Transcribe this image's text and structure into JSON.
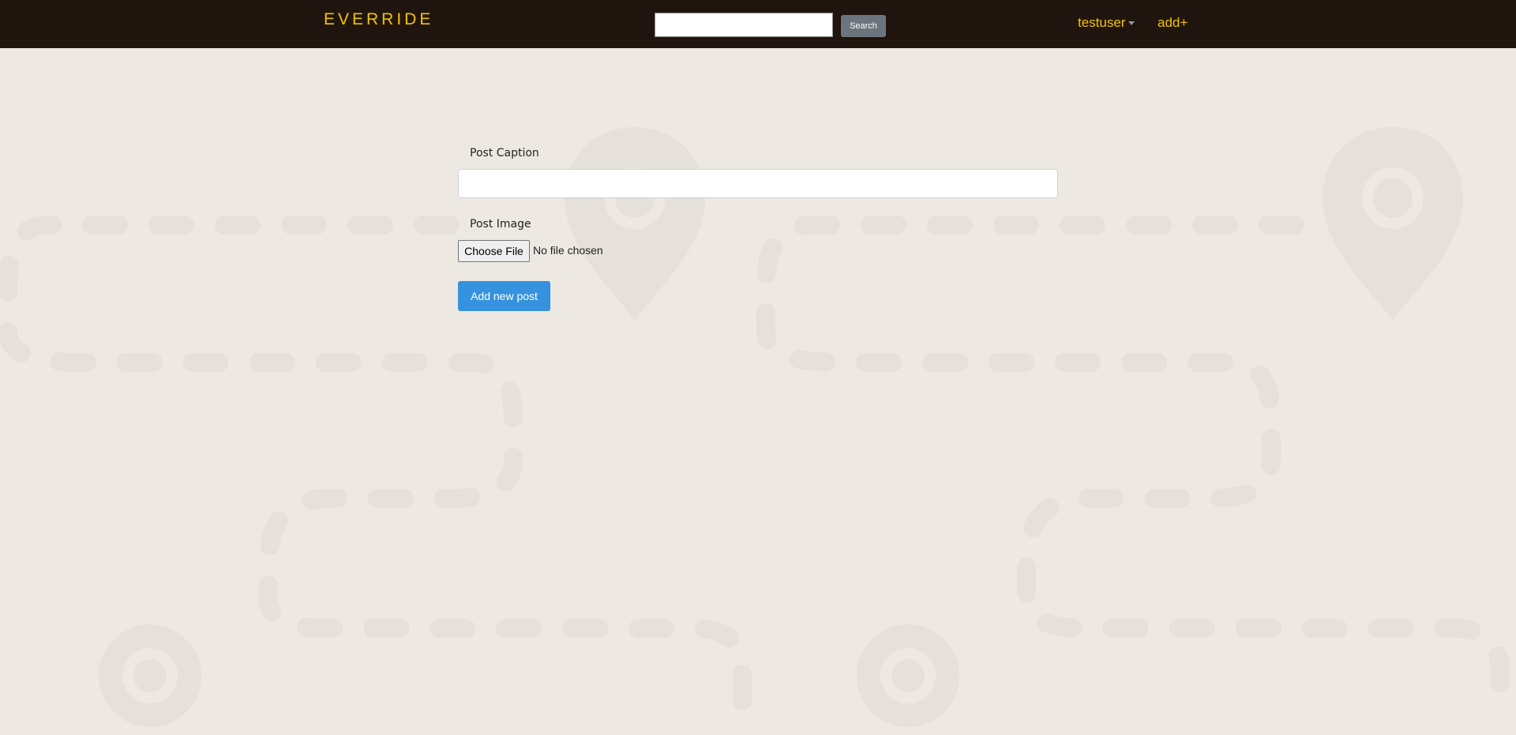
{
  "navbar": {
    "brand": "EVERRIDE",
    "search_value": "",
    "search_button": "Search",
    "user_menu": "testuser",
    "add_link": "add+"
  },
  "form": {
    "caption_label": "Post Caption",
    "caption_value": "",
    "image_label": "Post Image",
    "choose_file_button": "Choose File",
    "file_status": "No file chosen",
    "submit_button": "Add new post"
  },
  "colors": {
    "navbar_bg": "#20150e",
    "brand": "#f2c300",
    "page_bg": "#ede9e2",
    "primary_button": "#3592de"
  }
}
